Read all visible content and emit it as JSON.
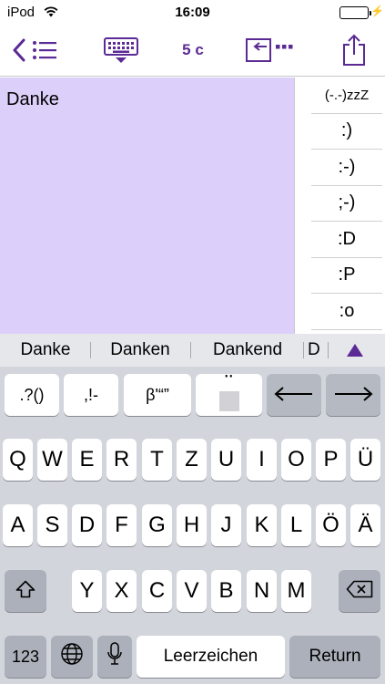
{
  "status_bar": {
    "carrier": "iPod",
    "time": "16:09"
  },
  "toolbar": {
    "back_icon": "chevron-left-icon",
    "list_icon": "list-icon",
    "keyboard_icon": "keyboard-dismiss-icon",
    "char_count": "5 c",
    "insert_icon": "insert-text-icon",
    "share_icon": "share-icon",
    "accent_color": "#5b2a94"
  },
  "editor": {
    "text": "Danke",
    "background": "#dcd0fa"
  },
  "emoticons": [
    "(-.-)zzZ",
    ":)",
    ":-)",
    ";-)",
    ":D",
    ":P",
    ":o"
  ],
  "suggestions": [
    "Danke",
    "Danken",
    "Dankend",
    "D"
  ],
  "symbol_row": [
    ".?()",
    ",!-",
    "β'“”",
    "¨"
  ],
  "keyboard": {
    "row1": [
      "Q",
      "W",
      "E",
      "R",
      "T",
      "Z",
      "U",
      "I",
      "O",
      "P",
      "Ü"
    ],
    "row2": [
      "A",
      "S",
      "D",
      "F",
      "G",
      "H",
      "J",
      "K",
      "L",
      "Ö",
      "Ä"
    ],
    "row3": [
      "Y",
      "X",
      "C",
      "V",
      "B",
      "N",
      "M"
    ],
    "numbers_label": "123",
    "space_label": "Leerzeichen",
    "return_label": "Return"
  }
}
